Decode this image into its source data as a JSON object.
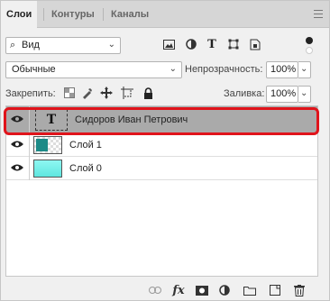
{
  "tabs": [
    {
      "label": "Слои",
      "active": true
    },
    {
      "label": "Контуры",
      "active": false
    },
    {
      "label": "Каналы",
      "active": false
    }
  ],
  "filter": {
    "kind_label": "Вид"
  },
  "blend": {
    "mode": "Обычные"
  },
  "opacity": {
    "label": "Непрозрачность:",
    "value": "100%"
  },
  "lock": {
    "label": "Закрепить:"
  },
  "fill": {
    "label": "Заливка:",
    "value": "100%"
  },
  "layers": [
    {
      "name": "Сидоров Иван Петрович",
      "type": "text",
      "visible": true,
      "selected": true,
      "thumb_glyph": "T"
    },
    {
      "name": "Слой 1",
      "type": "pixel",
      "visible": true,
      "selected": false
    },
    {
      "name": "Слой 0",
      "type": "pixel",
      "visible": true,
      "selected": false
    }
  ],
  "bottom_toolbar": {
    "fx_label": "fx"
  },
  "colors": {
    "highlight": "#e0141b",
    "selected_row": "#aaaaaa",
    "thumb_cyan": "#74f3ec"
  }
}
